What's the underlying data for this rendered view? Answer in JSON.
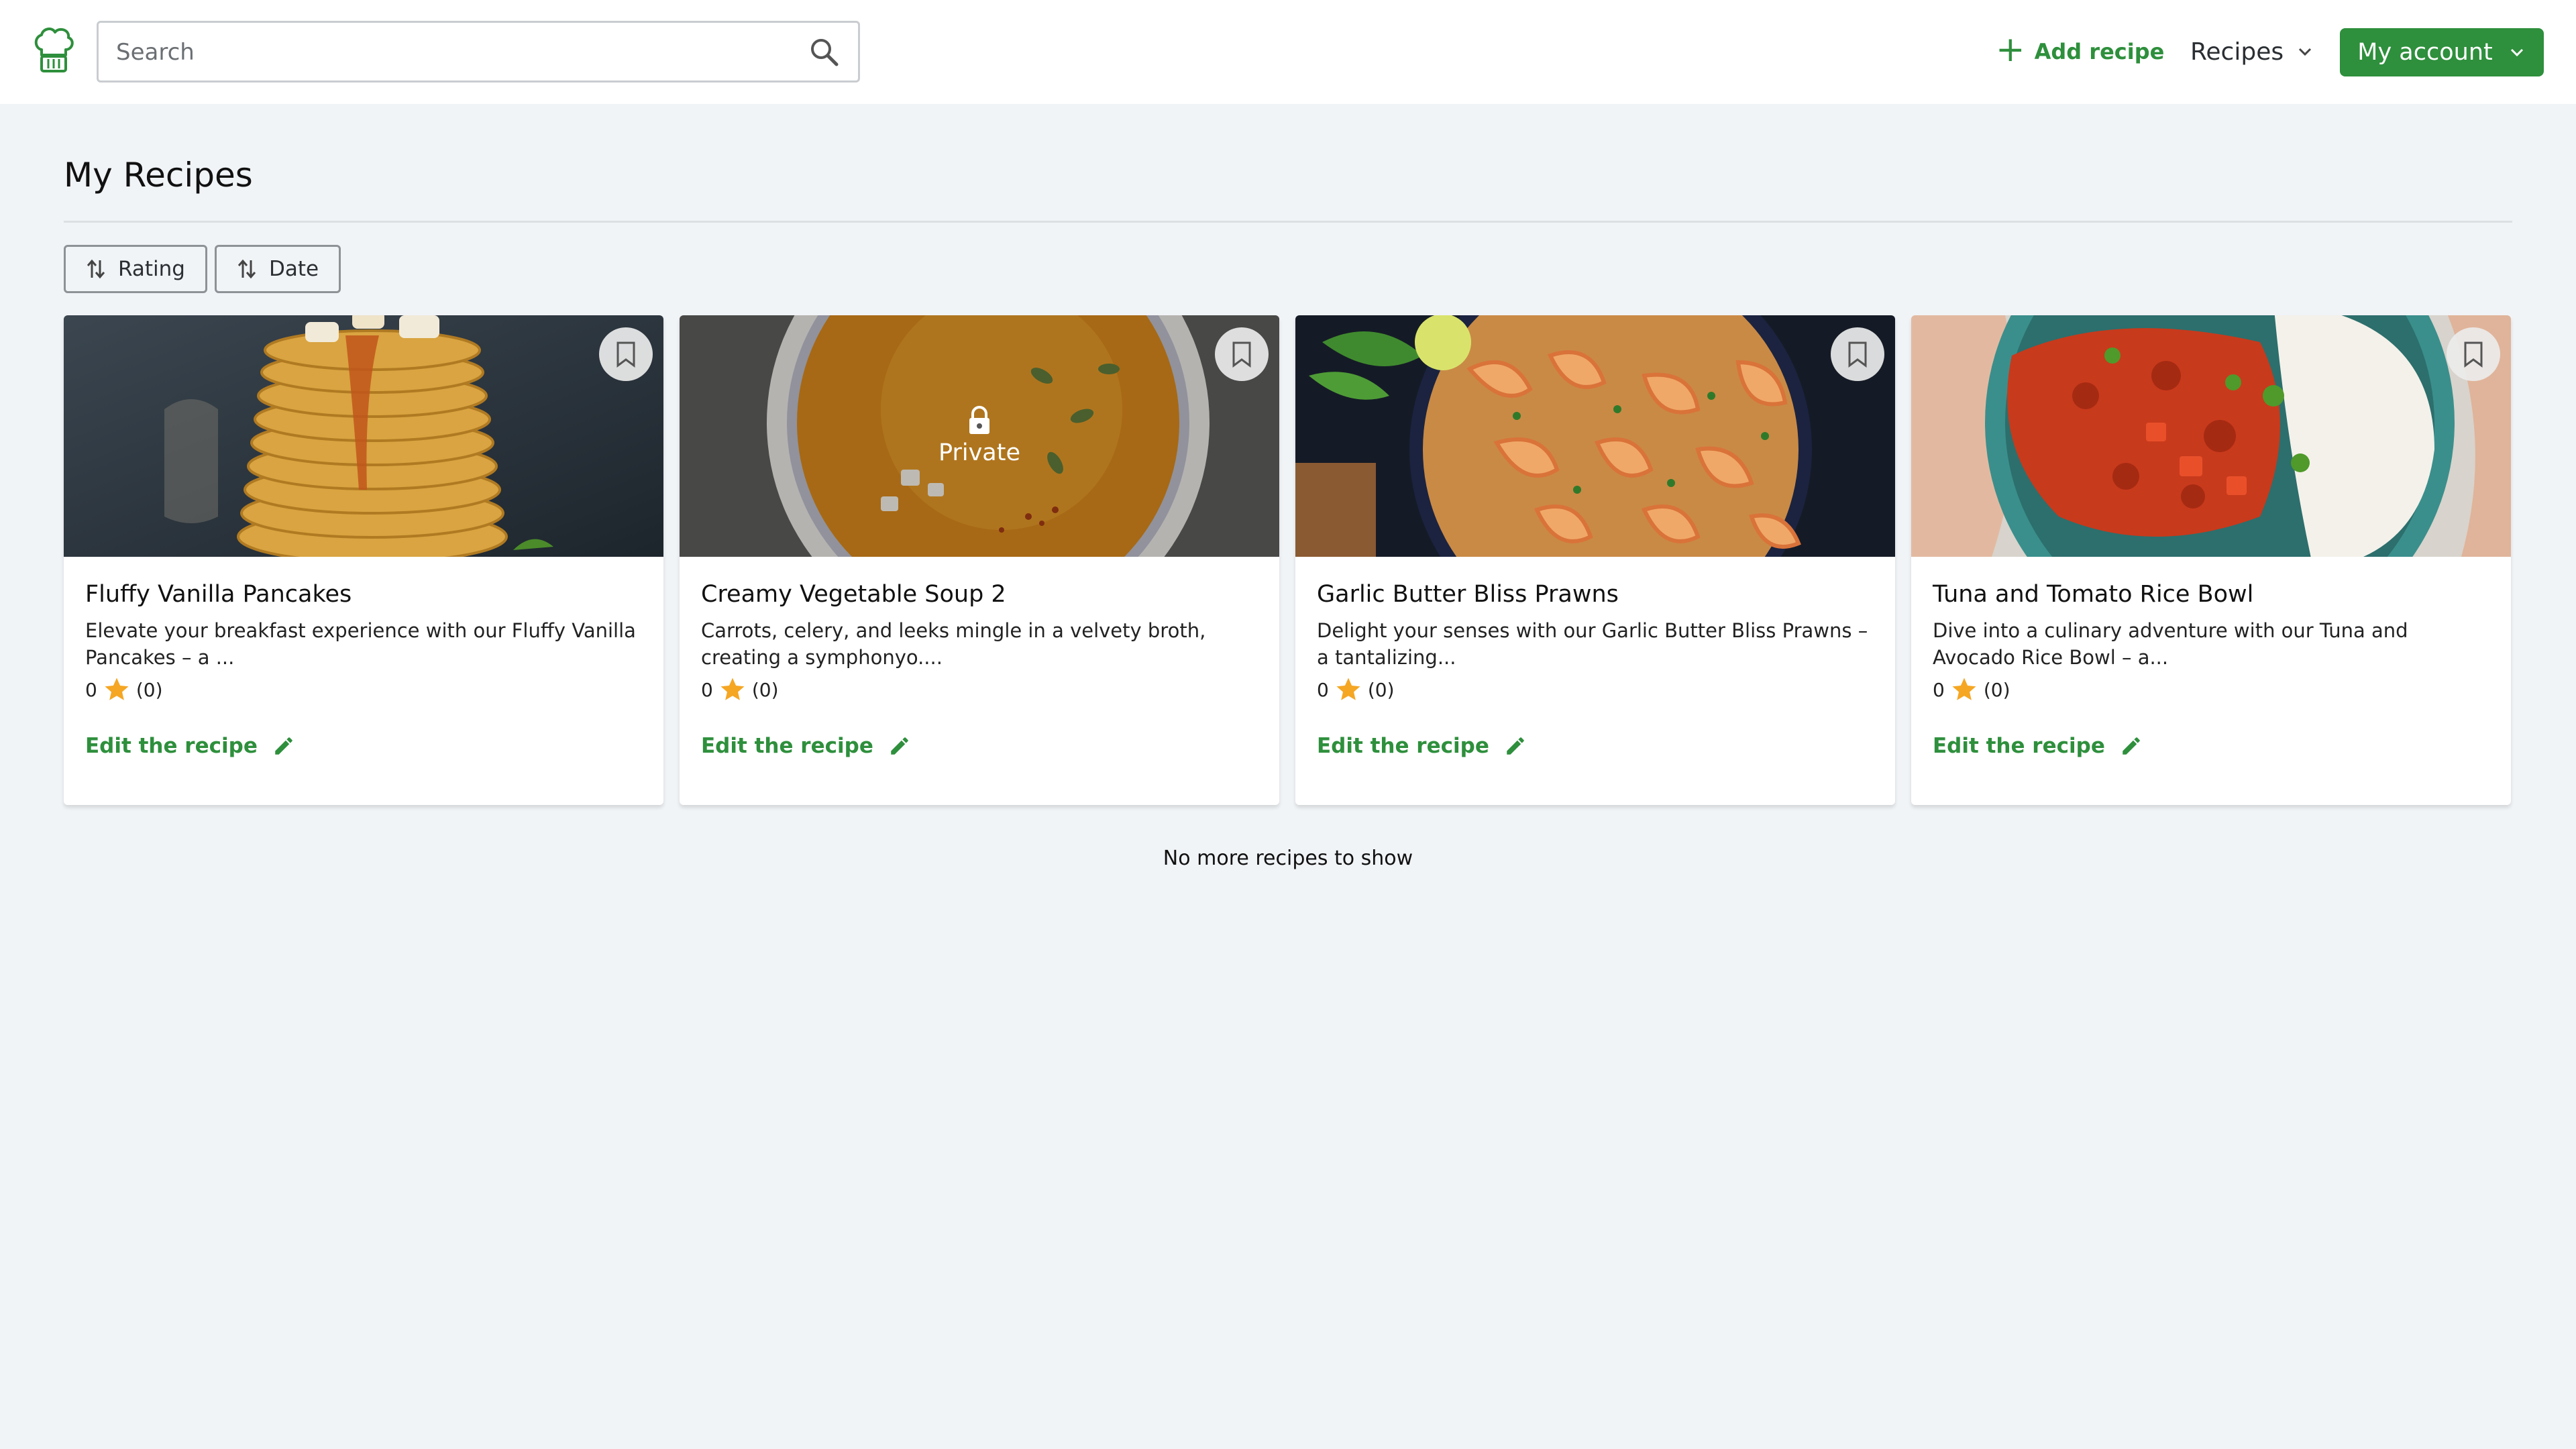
{
  "header": {
    "logo_icon": "chef-hat-icon",
    "search": {
      "placeholder": "Search",
      "value": ""
    },
    "add_recipe_label": "Add recipe",
    "recipes_menu_label": "Recipes",
    "account_label": "My account"
  },
  "main": {
    "title": "My Recipes",
    "sort": [
      {
        "label": "Rating",
        "icon": "sort-arrows-icon"
      },
      {
        "label": "Date",
        "icon": "sort-arrows-icon"
      }
    ],
    "recipes": [
      {
        "title": "Fluffy Vanilla Pancakes",
        "description": "Elevate your breakfast experience with our Fluffy Vanilla Pancakes – a ...",
        "rating": "0",
        "count": "(0)",
        "edit_label": "Edit the recipe",
        "private": false,
        "private_label": ""
      },
      {
        "title": "Creamy Vegetable Soup 2",
        "description": "Carrots, celery, and leeks mingle in a velvety broth, creating a symphonyo....",
        "rating": "0",
        "count": "(0)",
        "edit_label": "Edit the recipe",
        "private": true,
        "private_label": "Private"
      },
      {
        "title": "Garlic Butter Bliss Prawns",
        "description": "Delight your senses with our Garlic Butter Bliss Prawns – a tantalizing...",
        "rating": "0",
        "count": "(0)",
        "edit_label": "Edit the recipe",
        "private": false,
        "private_label": ""
      },
      {
        "title": "Tuna and Tomato Rice Bowl",
        "description": "Dive into a culinary adventure with our Tuna and Avocado Rice Bowl – a...",
        "rating": "0",
        "count": "(0)",
        "edit_label": "Edit the recipe",
        "private": false,
        "private_label": ""
      }
    ],
    "end_message": "No more recipes to show"
  },
  "colors": {
    "brand_green": "#2e8f3c",
    "background": "#f1f4f7",
    "star": "#f5a623"
  }
}
